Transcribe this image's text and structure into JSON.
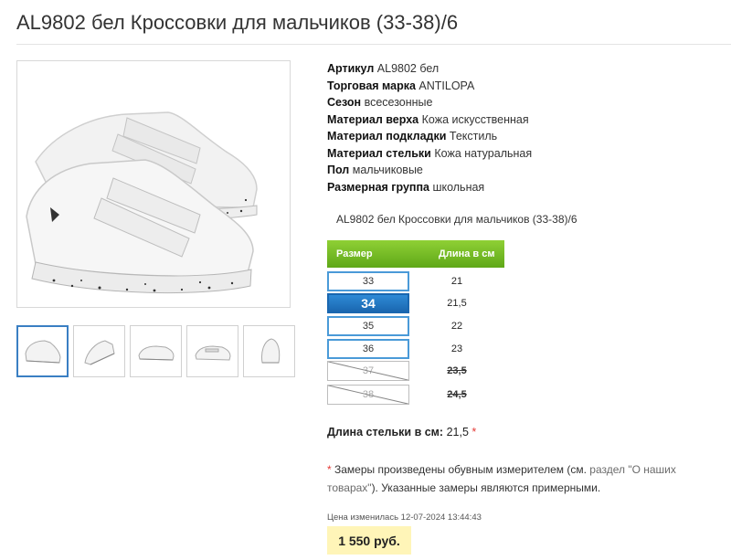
{
  "title": "AL9802 бел Кроссовки для мальчиков (33-38)/6",
  "properties": [
    {
      "label": "Артикул",
      "value": "AL9802 бел"
    },
    {
      "label": "Торговая марка",
      "value": "ANTILOPA"
    },
    {
      "label": "Сезон",
      "value": "всесезонные"
    },
    {
      "label": "Материал верха",
      "value": "Кожа искусственная"
    },
    {
      "label": "Материал подкладки",
      "value": "Текстиль"
    },
    {
      "label": "Материал стельки",
      "value": "Кожа натуральная"
    },
    {
      "label": "Пол",
      "value": "мальчиковые"
    },
    {
      "label": "Размерная группа",
      "value": "школьная"
    }
  ],
  "subtitle": "AL9802 бел Кроссовки для мальчиков (33-38)/6",
  "size_table": {
    "header_size": "Размер",
    "header_length": "Длина в см",
    "rows": [
      {
        "size": "33",
        "length": "21",
        "state": "available"
      },
      {
        "size": "34",
        "length": "21,5",
        "state": "selected"
      },
      {
        "size": "35",
        "length": "22",
        "state": "available"
      },
      {
        "size": "36",
        "length": "23",
        "state": "available"
      },
      {
        "size": "37",
        "length": "23,5",
        "state": "unavailable"
      },
      {
        "size": "38",
        "length": "24,5",
        "state": "unavailable"
      }
    ]
  },
  "insole": {
    "label": "Длина стельки в см:",
    "value": "21,5",
    "mark": "*"
  },
  "note": {
    "mark": "*",
    "text_before": " Замеры произведены обувным измерителем (см. ",
    "link": "раздел \"О наших товарах\"",
    "text_after": "). Указанные замеры являются примерными."
  },
  "price_changed": "Цена изменилась 12-07-2024 13:44:43",
  "price": "1 550 руб.",
  "colors": {
    "accent_green": "#6cb521",
    "accent_blue": "#1a67b0",
    "price_bg": "#fff5b8"
  },
  "icons": [
    "shoe-photo-main",
    "shoe-thumb"
  ]
}
